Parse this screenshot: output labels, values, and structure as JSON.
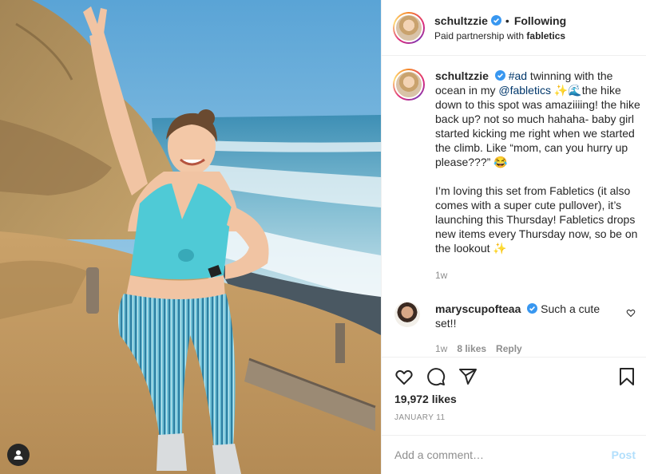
{
  "header": {
    "username": "schultzzie",
    "separator": "•",
    "follow_status": "Following",
    "partnership_prefix": "Paid partnership with",
    "partner": "fabletics"
  },
  "caption": {
    "username": "schultzzie",
    "hashtag": "#ad",
    "text1": " twinning with the ocean in my ",
    "mention": "@fabletics",
    "text2": " ✨🌊the hike down to this spot was amaziiiing! the hike back up? not so much hahaha- baby girl started kicking me right when we started the climb. Like “mom, can you hurry up please???” 😂",
    "text3": "I’m loving this set from Fabletics (it also comes with a super cute pullover), it’s launching this Thursday! Fabletics drops new items every Thursday now, so be on the lookout ✨",
    "time": "1w"
  },
  "comment": {
    "username": "maryscupofteaa",
    "text": " Such a cute set!!",
    "time": "1w",
    "likes": "8 likes",
    "reply": "Reply"
  },
  "post": {
    "likes": "19,972 likes",
    "date": "January 11"
  },
  "comment_box": {
    "placeholder": "Add a comment…",
    "post_label": "Post"
  },
  "colors": {
    "accent_link": "#00376b",
    "verified": "#3897f0",
    "post_disabled": "#b2dffc"
  },
  "icons": [
    "user-tag-icon",
    "verified-badge-icon",
    "heart-icon",
    "comment-icon",
    "share-icon",
    "bookmark-icon"
  ]
}
